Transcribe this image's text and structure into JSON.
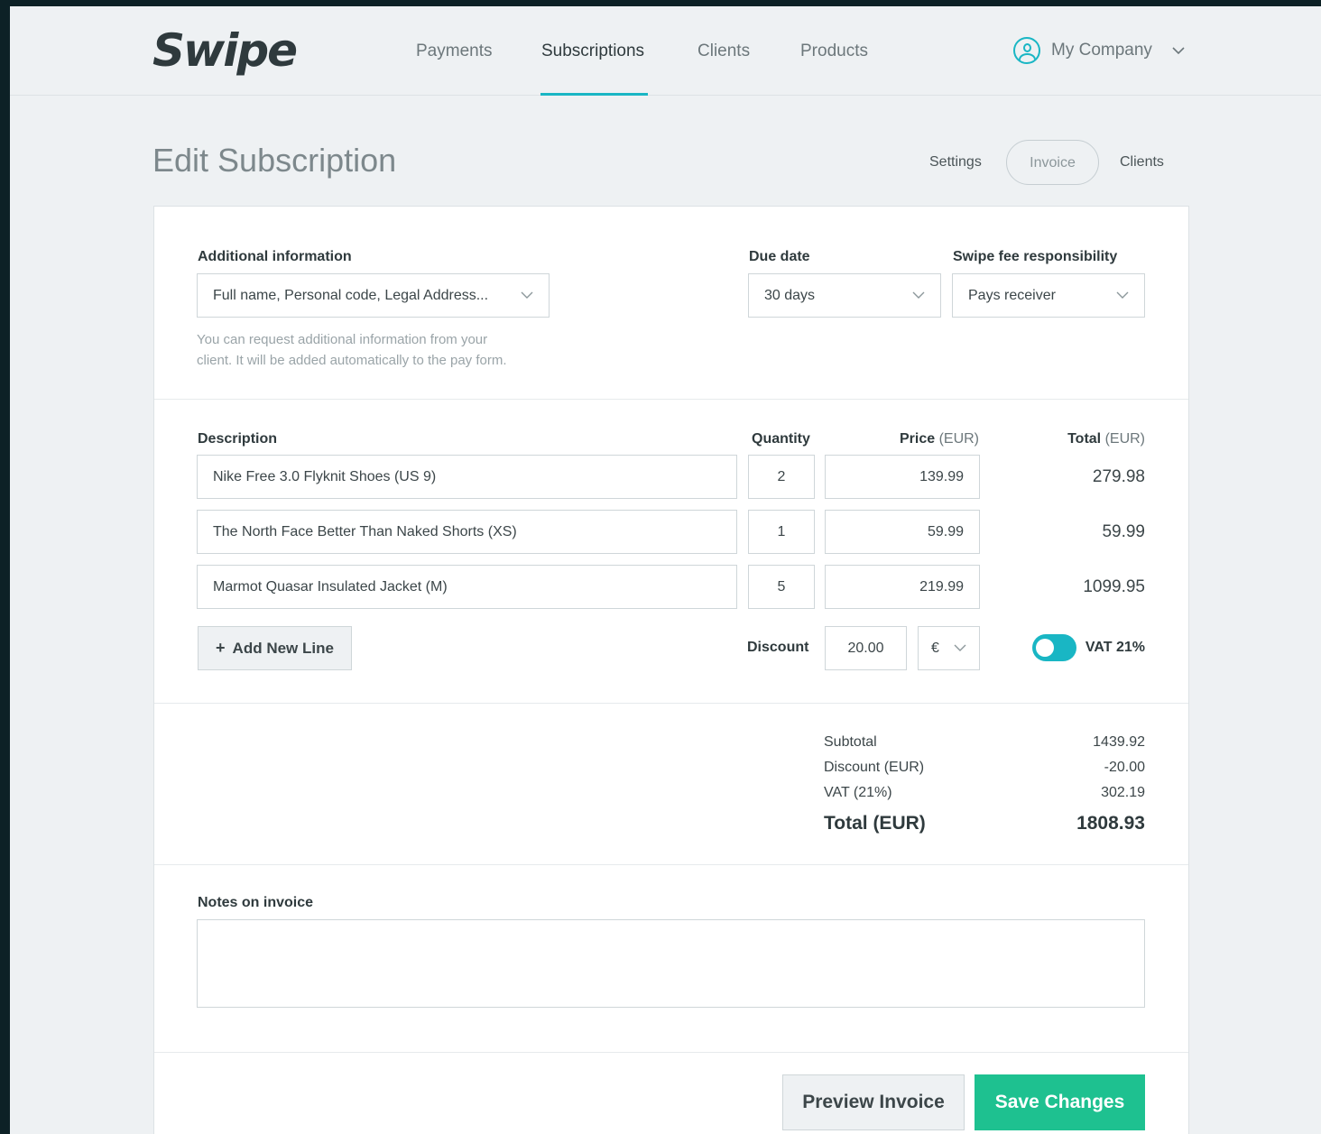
{
  "app": {
    "logo": "Swipe"
  },
  "nav": {
    "items": [
      "Payments",
      "Subscriptions",
      "Clients",
      "Products"
    ],
    "active": "Subscriptions",
    "account_label": "My Company"
  },
  "page": {
    "title": "Edit Subscription",
    "subtabs": [
      "Settings",
      "Invoice",
      "Clients"
    ],
    "active_subtab": "Invoice"
  },
  "settings": {
    "additional_info_label": "Additional information",
    "additional_info_value": "Full name, Personal code, Legal Address...",
    "additional_info_hint_1": "You can request additional information from your",
    "additional_info_hint_2": "client. It will be added automatically to the pay form.",
    "due_date_label": "Due date",
    "due_date_value": "30 days",
    "fee_label": "Swipe fee responsibility",
    "fee_value": "Pays receiver"
  },
  "lines": {
    "headers": {
      "description": "Description",
      "quantity": "Quantity",
      "price": "Price",
      "price_unit": "(EUR)",
      "total": "Total",
      "total_unit": "(EUR)"
    },
    "rows": [
      {
        "description": "Nike Free 3.0 Flyknit Shoes (US 9)",
        "quantity": "2",
        "price": "139.99",
        "total": "279.98"
      },
      {
        "description": "The North Face Better Than Naked Shorts (XS)",
        "quantity": "1",
        "price": "59.99",
        "total": "59.99"
      },
      {
        "description": "Marmot Quasar Insulated Jacket (M)",
        "quantity": "5",
        "price": "219.99",
        "total": "1099.95"
      }
    ],
    "add_line_label": "Add New Line",
    "discount_label": "Discount",
    "discount_value": "20.00",
    "discount_currency": "€",
    "vat_label": "VAT 21%",
    "vat_enabled": true
  },
  "summary": {
    "subtotal_label": "Subtotal",
    "subtotal_value": "1439.92",
    "discount_label": "Discount (EUR)",
    "discount_value": "-20.00",
    "vat_label": "VAT (21%)",
    "vat_value": "302.19",
    "total_label": "Total (EUR)",
    "total_value": "1808.93"
  },
  "notes": {
    "label": "Notes on invoice",
    "value": ""
  },
  "actions": {
    "preview_label": "Preview Invoice",
    "save_label": "Save Changes"
  },
  "colors": {
    "accent": "#19b6c4",
    "save": "#1ec190",
    "background": "#eef1f3"
  },
  "icons": [
    "user-circle-icon",
    "chevron-down-icon",
    "plus-icon"
  ]
}
